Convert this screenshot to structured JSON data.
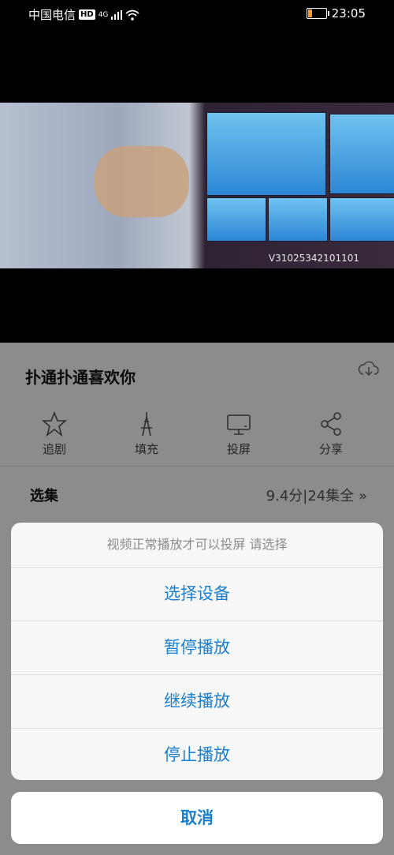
{
  "status_bar": {
    "carrier": "中国电信",
    "hd": "HD",
    "network": "4G",
    "time": "23:05",
    "battery_level": 0.2
  },
  "video": {
    "watermark_code": "V31025342101101"
  },
  "detail": {
    "title": "扑通扑通喜欢你",
    "actions": [
      {
        "icon": "star-icon",
        "label": "追剧"
      },
      {
        "icon": "tower-icon",
        "label": "填充"
      },
      {
        "icon": "screen-cast-icon",
        "label": "投屏"
      },
      {
        "icon": "share-icon",
        "label": "分享"
      }
    ],
    "episodes_label": "选集",
    "episodes_info": "9.4分|24集全",
    "episodes_chevron": "»"
  },
  "action_sheet": {
    "title": "视频正常播放才可以投屏 请选择",
    "items": [
      "选择设备",
      "暂停播放",
      "继续播放",
      "停止播放"
    ],
    "cancel": "取消"
  },
  "colors": {
    "accent": "#1a7fcf",
    "battery": "#f29a2e"
  }
}
